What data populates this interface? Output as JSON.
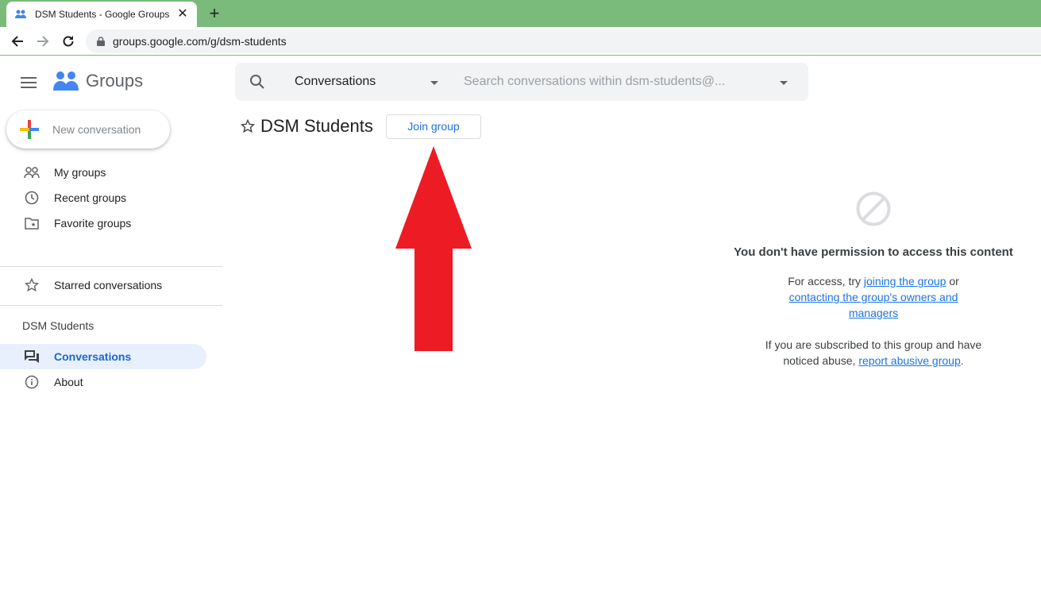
{
  "browser": {
    "tab_title": "DSM Students - Google Groups",
    "url": "groups.google.com/g/dsm-students",
    "colors": {
      "frame": "#7aba7a"
    }
  },
  "app": {
    "logo_text": "Groups",
    "search_scope": "Conversations",
    "search_placeholder": "Search conversations within dsm-students@..."
  },
  "sidebar": {
    "new_conversation_label": "New conversation",
    "items": [
      {
        "label": "My groups",
        "icon": "people-icon"
      },
      {
        "label": "Recent groups",
        "icon": "clock-icon"
      },
      {
        "label": "Favorite groups",
        "icon": "folder-star-icon"
      }
    ],
    "starred_label": "Starred conversations",
    "group_section_label": "DSM Students",
    "group_items": [
      {
        "label": "Conversations",
        "icon": "forum-icon",
        "active": true
      },
      {
        "label": "About",
        "icon": "info-icon",
        "active": false
      }
    ]
  },
  "main": {
    "group_title": "DSM Students",
    "join_label": "Join group",
    "annotation": {
      "type": "red-arrow",
      "color": "#ed1c24",
      "points_to": "join-group-button"
    }
  },
  "permission": {
    "title": "You don't have permission to access this content",
    "line1_prefix": "For access, try ",
    "link_join": "joining the group",
    "line1_mid": " or",
    "link_contact": "contacting the group's owners and managers",
    "line2_prefix": "If you are subscribed to this group and have noticed abuse, ",
    "link_report": "report abusive group",
    "line2_suffix": "."
  }
}
